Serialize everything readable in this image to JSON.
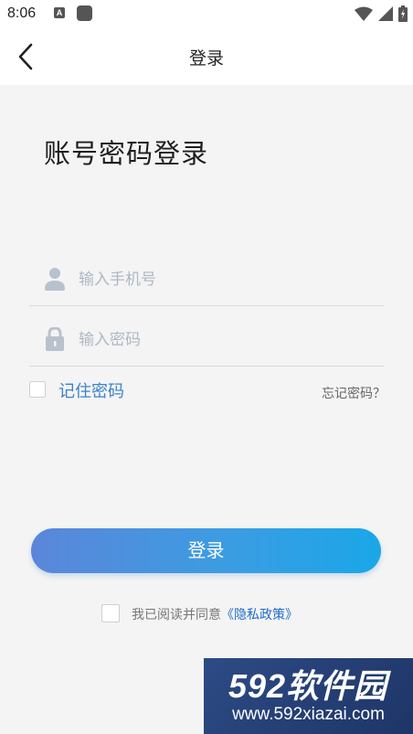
{
  "status_bar": {
    "time": "8:06",
    "app_icon_letter": "A"
  },
  "app_bar": {
    "title": "登录",
    "back_icon": "chevron-left-icon"
  },
  "heading": "账号密码登录",
  "phone_field": {
    "placeholder": "输入手机号",
    "value": "",
    "icon": "user-icon"
  },
  "password_field": {
    "placeholder": "输入密码",
    "value": "",
    "icon": "lock-icon"
  },
  "remember": {
    "label": "记住密码",
    "checked": false
  },
  "forgot_link": "忘记密码？",
  "login_button": "登录",
  "agreement": {
    "prefix": "我已阅读并同意",
    "link": "《隐私政策》",
    "checked": false
  },
  "watermark": {
    "title": "592软件园",
    "url": "www.592xiazai.com"
  },
  "colors": {
    "accent": "#3b82cc",
    "button_start": "#5b86d9",
    "button_end": "#1aa7e8",
    "link": "#1f6dc7"
  }
}
